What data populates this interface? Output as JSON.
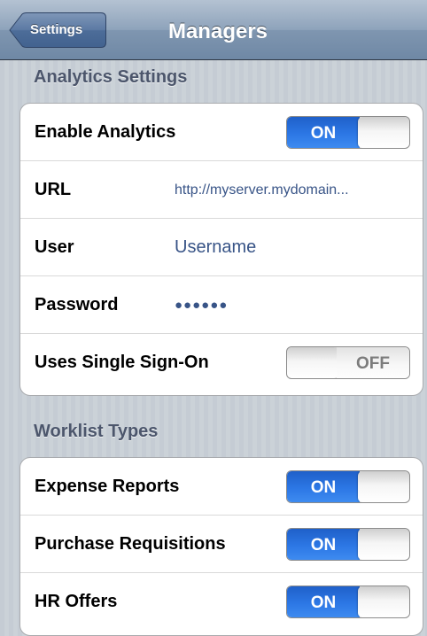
{
  "navbar": {
    "back_label": "Settings",
    "title": "Managers"
  },
  "analytics": {
    "header": "Analytics Settings",
    "enable": {
      "label": "Enable Analytics",
      "state": "ON"
    },
    "url": {
      "label": "URL",
      "value": "http://myserver.mydomain..."
    },
    "user": {
      "label": "User",
      "placeholder": "Username"
    },
    "password": {
      "label": "Password",
      "value": "●●●●●●"
    },
    "sso": {
      "label": "Uses Single Sign-On",
      "state": "OFF"
    }
  },
  "worklist": {
    "header": "Worklist Types",
    "items": [
      {
        "label": "Expense Reports",
        "state": "ON"
      },
      {
        "label": "Purchase Requisitions",
        "state": "ON"
      },
      {
        "label": "HR Offers",
        "state": "ON"
      }
    ]
  },
  "colors": {
    "switch_on": "#2c77e5",
    "value_text": "#385487",
    "section_header": "#4c566c"
  }
}
